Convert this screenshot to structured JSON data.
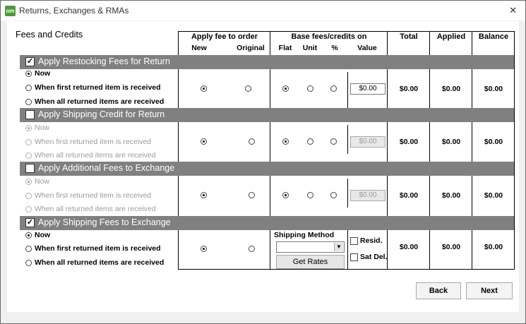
{
  "window": {
    "title": "Returns, Exchanges & RMAs",
    "app_icon": "om"
  },
  "section_title": "Fees and Credits",
  "columns": {
    "apply_fee": "Apply fee to order",
    "new": "New",
    "original": "Original",
    "base_fees": "Base fees/credits on",
    "flat": "Flat",
    "unit": "Unit",
    "percent": "%",
    "value": "Value",
    "total": "Total",
    "applied": "Applied",
    "balance": "Balance"
  },
  "groups": [
    {
      "label": "Apply Restocking Fees for Return",
      "checked": true,
      "options": [
        "Now",
        "When first returned item is received",
        "When all returned items are received"
      ],
      "value": "$0.00",
      "total": "$0.00",
      "applied": "$0.00",
      "balance": "$0.00"
    },
    {
      "label": "Apply Shipping Credit for Return",
      "checked": false,
      "options": [
        "Now",
        "When first returned item is received",
        "When all returned items are received"
      ],
      "value": "$0.00",
      "total": "$0.00",
      "applied": "$0.00",
      "balance": "$0.00"
    },
    {
      "label": "Apply Additional Fees to Exchange",
      "checked": false,
      "options": [
        "Now",
        "When first returned item is received",
        "When all returned items are received"
      ],
      "value": "$0.00",
      "total": "$0.00",
      "applied": "$0.00",
      "balance": "$0.00"
    },
    {
      "label": "Apply Shipping Fees to Exchange",
      "checked": true,
      "options": [
        "Now",
        "When first returned item is received",
        "When all returned items are received"
      ],
      "shipping_method_label": "Shipping Method",
      "shipping_method_value": "",
      "get_rates": "Get Rates",
      "resid": "Resid.",
      "sat_del": "Sat Del.",
      "total": "$0.00",
      "applied": "$0.00",
      "balance": "$0.00"
    }
  ],
  "buttons": {
    "back": "Back",
    "next": "Next"
  },
  "colors": {
    "group_bar": "#808080",
    "app_icon": "#4e9a3a"
  }
}
